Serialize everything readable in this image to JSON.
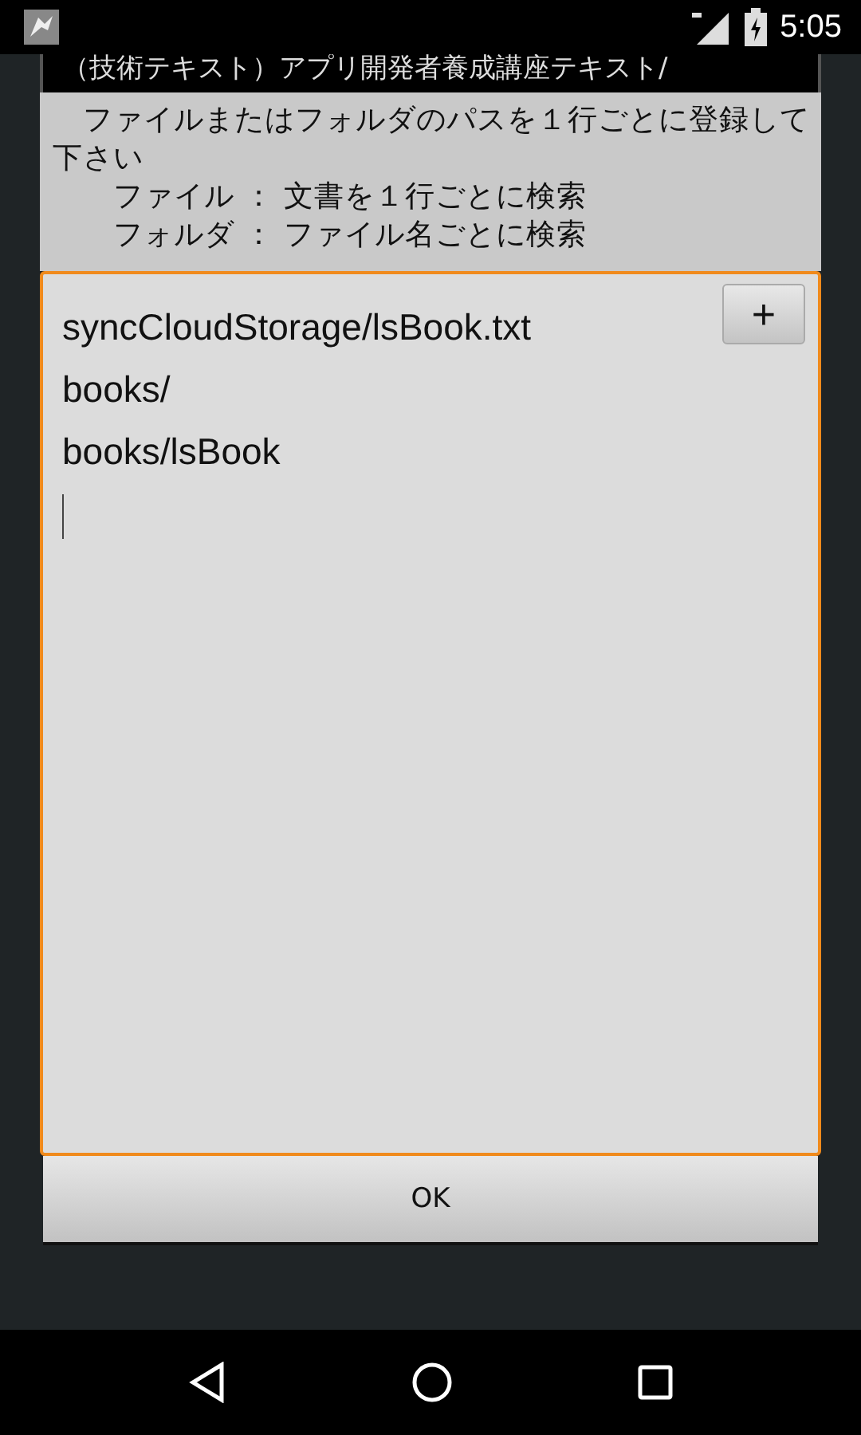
{
  "status_bar": {
    "time": "5:05"
  },
  "background_list": [
    "（技術テキスト）アプリ開発者養成講座テキスト/"
  ],
  "dialog": {
    "message": [
      "　ファイルまたはフォルダのパスを１行ごとに登録して下さい",
      "　　ファイル ： 文書を１行ごとに検索",
      "　　フォルダ ： ファイル名ごとに検索"
    ],
    "field": {
      "lines": [
        "syncCloudStorage/lsBook.txt",
        "books/",
        "books/lsBook"
      ],
      "focused": true
    },
    "add_button": "+",
    "ok_button": "OK"
  }
}
